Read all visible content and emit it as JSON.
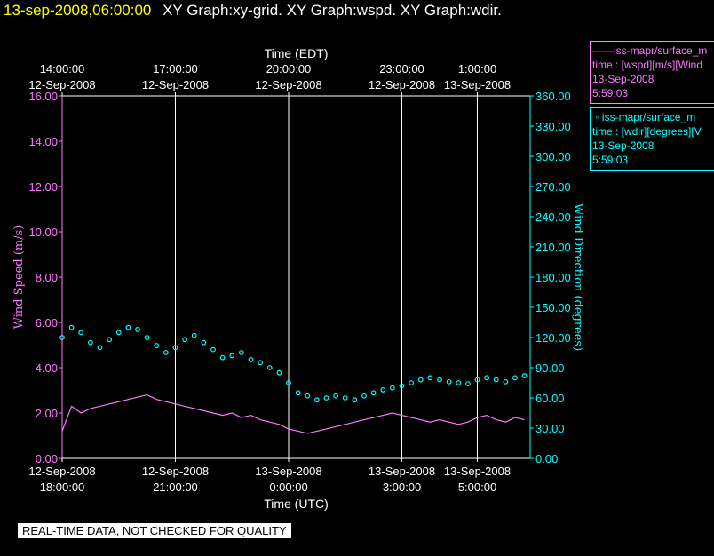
{
  "header": {
    "timestamp": "13-sep-2008,06:00:00",
    "graphs": "XY Graph:xy-grid.  XY Graph:wspd.  XY Graph:wdir."
  },
  "legend": [
    {
      "series": "iss-mapr/surface_m",
      "desc": "time : [wspd][m/s][Wind",
      "date": "13-Sep-2008",
      "time": "5:59:03"
    },
    {
      "series": "iss-mapr/surface_m",
      "desc": "time : [wdir][degrees][V",
      "date": "13-Sep-2008",
      "time": "5:59:03"
    }
  ],
  "disclaimer": "REAL-TIME DATA, NOT CHECKED FOR QUALITY",
  "colors": {
    "speed": "#ff77ff",
    "direction": "#00ffff",
    "grid": "#ffffff",
    "axis_text": "#ffffff"
  },
  "chart_data": {
    "type": "line",
    "top_axis_title": "Time (EDT)",
    "bottom_axis_title": "Time (UTC)",
    "ylabel_left": "Wind Speed (m/s)",
    "ylabel_right": "Wind Direction (degrees)",
    "xlim_hours_utc": [
      0,
      12.4
    ],
    "ylim_left": [
      0,
      16
    ],
    "ylim_right": [
      0,
      360
    ],
    "left_ticks": [
      "0.00",
      "2.00",
      "4.00",
      "6.00",
      "8.00",
      "10.00",
      "12.00",
      "14.00",
      "16.00"
    ],
    "right_ticks": [
      "0.00",
      "30.00",
      "60.00",
      "90.00",
      "120.00",
      "150.00",
      "180.00",
      "210.00",
      "240.00",
      "270.00",
      "300.00",
      "330.00",
      "360.00"
    ],
    "bottom_ticks": [
      {
        "hour": 0,
        "date": "12-Sep-2008",
        "time": "18:00:00"
      },
      {
        "hour": 3,
        "date": "12-Sep-2008",
        "time": "21:00:00"
      },
      {
        "hour": 6,
        "date": "13-Sep-2008",
        "time": "0:00:00"
      },
      {
        "hour": 9,
        "date": "13-Sep-2008",
        "time": "3:00:00"
      },
      {
        "hour": 11,
        "date": "13-Sep-2008",
        "time": "5:00:00"
      }
    ],
    "top_ticks": [
      {
        "hour": 0,
        "time": "14:00:00",
        "date": "12-Sep-2008"
      },
      {
        "hour": 3,
        "time": "17:00:00",
        "date": "12-Sep-2008"
      },
      {
        "hour": 6,
        "time": "20:00:00",
        "date": "12-Sep-2008"
      },
      {
        "hour": 9,
        "time": "23:00:00",
        "date": "12-Sep-2008"
      },
      {
        "hour": 11,
        "time": "1:00:00",
        "date": "13-Sep-2008"
      }
    ],
    "grid_hours": [
      3,
      6,
      9,
      11
    ],
    "series": [
      {
        "name": "wspd",
        "axis": "left",
        "style": "line",
        "x": [
          0,
          0.25,
          0.5,
          0.75,
          1,
          1.25,
          1.5,
          1.75,
          2,
          2.25,
          2.5,
          2.75,
          3,
          3.25,
          3.5,
          3.75,
          4,
          4.25,
          4.5,
          4.75,
          5,
          5.25,
          5.5,
          5.75,
          6,
          6.25,
          6.5,
          6.75,
          7,
          7.25,
          7.5,
          7.75,
          8,
          8.25,
          8.5,
          8.75,
          9,
          9.25,
          9.5,
          9.75,
          10,
          10.25,
          10.5,
          10.75,
          11,
          11.25,
          11.5,
          11.75,
          12,
          12.25
        ],
        "y": [
          1.2,
          2.3,
          2.0,
          2.2,
          2.3,
          2.4,
          2.5,
          2.6,
          2.7,
          2.8,
          2.6,
          2.5,
          2.4,
          2.3,
          2.2,
          2.1,
          2.0,
          1.9,
          2.0,
          1.8,
          1.9,
          1.7,
          1.6,
          1.5,
          1.3,
          1.2,
          1.1,
          1.2,
          1.3,
          1.4,
          1.5,
          1.6,
          1.7,
          1.8,
          1.9,
          2.0,
          1.9,
          1.8,
          1.7,
          1.6,
          1.7,
          1.6,
          1.5,
          1.6,
          1.8,
          1.9,
          1.7,
          1.6,
          1.8,
          1.7
        ]
      },
      {
        "name": "wdir",
        "axis": "right",
        "style": "scatter",
        "x": [
          0,
          0.25,
          0.5,
          0.75,
          1,
          1.25,
          1.5,
          1.75,
          2,
          2.25,
          2.5,
          2.75,
          3,
          3.25,
          3.5,
          3.75,
          4,
          4.25,
          4.5,
          4.75,
          5,
          5.25,
          5.5,
          5.75,
          6,
          6.25,
          6.5,
          6.75,
          7,
          7.25,
          7.5,
          7.75,
          8,
          8.25,
          8.5,
          8.75,
          9,
          9.25,
          9.5,
          9.75,
          10,
          10.25,
          10.5,
          10.75,
          11,
          11.25,
          11.5,
          11.75,
          12,
          12.25
        ],
        "y": [
          120,
          130,
          125,
          115,
          110,
          118,
          125,
          130,
          128,
          120,
          112,
          105,
          110,
          118,
          122,
          115,
          108,
          100,
          102,
          105,
          98,
          95,
          90,
          85,
          75,
          65,
          62,
          58,
          60,
          62,
          60,
          58,
          62,
          65,
          68,
          70,
          72,
          75,
          78,
          80,
          78,
          76,
          75,
          74,
          78,
          80,
          78,
          76,
          80,
          82
        ]
      }
    ]
  }
}
